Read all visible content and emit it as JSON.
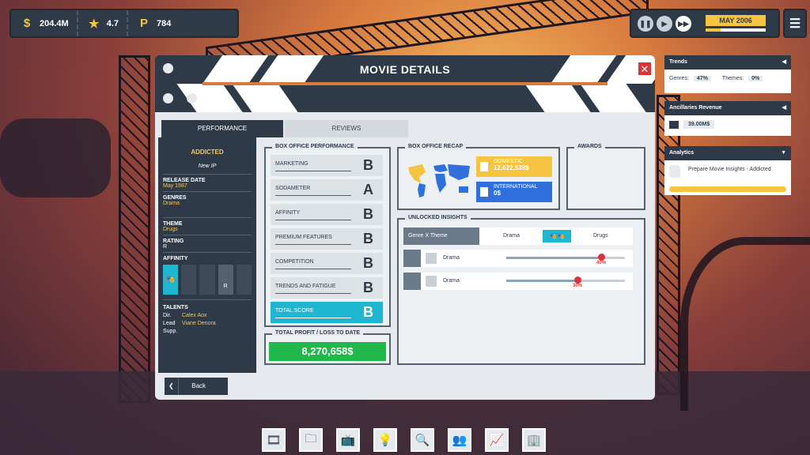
{
  "hud": {
    "money": "204.4M",
    "rating": "4.7",
    "points": "784",
    "date": "MAY 2006"
  },
  "panel": {
    "title": "MOVIE DETAILS",
    "tabs": [
      "PERFORMANCE",
      "REVIEWS"
    ],
    "back": "Back"
  },
  "movie": {
    "title": "ADDICTED",
    "ip": "New IP",
    "release_label": "RELEASE DATE",
    "release": "May 1987",
    "genres_label": "GENRES",
    "genres": "Drama",
    "theme_label": "THEME",
    "theme": "Drugs",
    "rating_label": "RATING",
    "rating": "R",
    "affinity_label": "AFFINITY",
    "affinity_r": "R",
    "talents_label": "TALENTS",
    "dir_label": "Dir.",
    "dir": "Calex Aox",
    "lead_label": "Lead",
    "lead": "Viane Denora",
    "supp_label": "Supp."
  },
  "box_office": {
    "header": "BOX OFFICE PERFORMANCE",
    "rows": [
      {
        "label": "MARKETING",
        "grade": "B"
      },
      {
        "label": "SODAMETER",
        "grade": "A"
      },
      {
        "label": "AFFINITY",
        "grade": "B"
      },
      {
        "label": "PREMIUM FEATURES",
        "grade": "B"
      },
      {
        "label": "COMPETITION",
        "grade": "B"
      },
      {
        "label": "TRENDS AND FATIGUE",
        "grade": "B"
      },
      {
        "label": "TOTAL SCORE",
        "grade": "B"
      }
    ]
  },
  "profit": {
    "header": "TOTAL PROFIT / LOSS TO DATE",
    "value": "8,270,658$"
  },
  "recap": {
    "header": "BOX OFFICE RECAP",
    "domestic_label": "DOMESTIC",
    "domestic": "12,622,539$",
    "intl_label": "INTERNATIONAL",
    "intl": "0$"
  },
  "awards": {
    "header": "AWARDS"
  },
  "insights": {
    "header": "UNLOCKED INSIGHTS",
    "combo": "Genre X Theme",
    "genre": "Drama",
    "theme": "Drugs",
    "bars": [
      {
        "label": "Drama",
        "pct": "40%",
        "fill": 0.8
      },
      {
        "label": "Drama",
        "pct": "30%",
        "fill": 0.6
      }
    ]
  },
  "sidebar": {
    "trends": "Trends",
    "genres_label": "Genres:",
    "genres_pct": "47%",
    "themes_label": "Themes:",
    "themes_pct": "0%",
    "anc": "Ancillaries Revenue",
    "anc_val": "39.00M$",
    "analytics": "Analytics",
    "analytics_item": "Prepare Movie Insights - Addicted"
  },
  "colors": {
    "accent": "#1fb6d2",
    "dark": "#2f3a49",
    "gold": "#f5c542",
    "green": "#20b84a",
    "red": "#d9343a"
  }
}
